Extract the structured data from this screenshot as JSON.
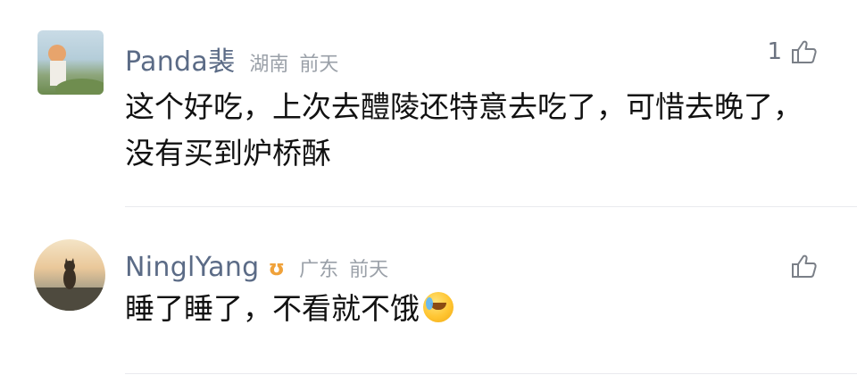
{
  "comments": [
    {
      "avatar": "landscape-photo-avatar",
      "username": "Panda裴",
      "badge": "",
      "location": "湖南",
      "time": "前天",
      "like_count": "1",
      "content": "这个好吃，上次去醴陵还特意去吃了，可惜去晚了，没有买到炉桥酥"
    },
    {
      "avatar": "cat-silhouette-avatar",
      "username": "NinglYang",
      "badge": "ʊ",
      "location": "广东",
      "time": "前天",
      "like_count": "",
      "content": "睡了睡了，不看就不饿"
    }
  ],
  "colors": {
    "username": "#5b6b86",
    "meta": "#9aa0a8",
    "badge": "#f0a23a",
    "content": "#111111",
    "divider": "#e9eaee"
  }
}
